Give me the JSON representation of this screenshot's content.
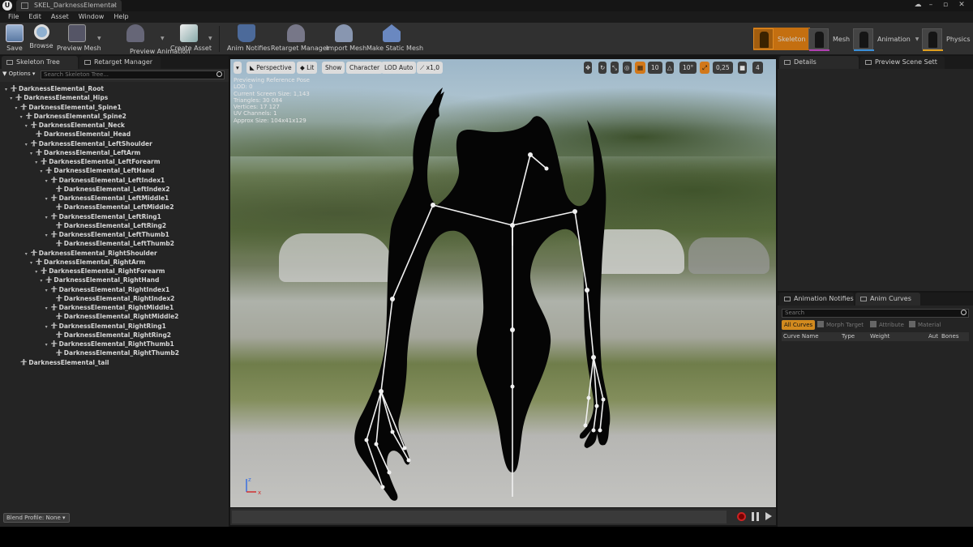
{
  "window": {
    "tab_title": "SKEL_DarknessElemental",
    "logo": "U"
  },
  "menu": [
    "File",
    "Edit",
    "Asset",
    "Window",
    "Help"
  ],
  "toolbar": {
    "save": "Save",
    "browse": "Browse",
    "preview_mesh": "Preview Mesh",
    "preview_animation": "Preview Animation",
    "create_asset": "Create Asset",
    "anim_notifies": "Anim Notifies",
    "retarget_manager": "Retarget Manager",
    "import_mesh": "Import Mesh",
    "make_static_mesh": "Make Static Mesh"
  },
  "modes": {
    "skeleton": "Skeleton",
    "mesh": "Mesh",
    "animation": "Animation",
    "physics": "Physics"
  },
  "left_panel": {
    "tab_skeleton_tree": "Skeleton Tree",
    "tab_retarget_manager": "Retarget Manager",
    "options": "Options",
    "search_placeholder": "Search Skeleton Tree...",
    "blend_profile": "Blend Profile: None",
    "bones": [
      {
        "name": "DarknessElemental_Root",
        "depth": 0
      },
      {
        "name": "DarknessElemental_Hips",
        "depth": 1
      },
      {
        "name": "DarknessElemental_Spine1",
        "depth": 2
      },
      {
        "name": "DarknessElemental_Spine2",
        "depth": 3
      },
      {
        "name": "DarknessElemental_Neck",
        "depth": 4
      },
      {
        "name": "DarknessElemental_Head",
        "depth": 5
      },
      {
        "name": "DarknessElemental_LeftShoulder",
        "depth": 4
      },
      {
        "name": "DarknessElemental_LeftArm",
        "depth": 5
      },
      {
        "name": "DarknessElemental_LeftForearm",
        "depth": 6
      },
      {
        "name": "DarknessElemental_LeftHand",
        "depth": 7
      },
      {
        "name": "DarknessElemental_LeftIndex1",
        "depth": 8
      },
      {
        "name": "DarknessElemental_LeftIndex2",
        "depth": 9
      },
      {
        "name": "DarknessElemental_LeftMiddle1",
        "depth": 8
      },
      {
        "name": "DarknessElemental_LeftMiddle2",
        "depth": 9
      },
      {
        "name": "DarknessElemental_LeftRing1",
        "depth": 8
      },
      {
        "name": "DarknessElemental_LeftRing2",
        "depth": 9
      },
      {
        "name": "DarknessElemental_LeftThumb1",
        "depth": 8
      },
      {
        "name": "DarknessElemental_LeftThumb2",
        "depth": 9
      },
      {
        "name": "DarknessElemental_RightShoulder",
        "depth": 4
      },
      {
        "name": "DarknessElemental_RightArm",
        "depth": 5
      },
      {
        "name": "DarknessElemental_RightForearm",
        "depth": 6
      },
      {
        "name": "DarknessElemental_RightHand",
        "depth": 7
      },
      {
        "name": "DarknessElemental_RightIndex1",
        "depth": 8
      },
      {
        "name": "DarknessElemental_RightIndex2",
        "depth": 9
      },
      {
        "name": "DarknessElemental_RightMiddle1",
        "depth": 8
      },
      {
        "name": "DarknessElemental_RightMiddle2",
        "depth": 9
      },
      {
        "name": "DarknessElemental_RightRing1",
        "depth": 8
      },
      {
        "name": "DarknessElemental_RightRing2",
        "depth": 9
      },
      {
        "name": "DarknessElemental_RightThumb1",
        "depth": 8
      },
      {
        "name": "DarknessElemental_RightThumb2",
        "depth": 9
      },
      {
        "name": "DarknessElemental_tail",
        "depth": 2
      }
    ]
  },
  "viewport": {
    "perspective": "Perspective",
    "lit": "Lit",
    "show": "Show",
    "character": "Character",
    "lod": "LOD Auto",
    "speed": "x1,0",
    "grid_snap": "10",
    "rot_snap": "10°",
    "scale_snap": "0,25",
    "cam_speed": "4",
    "stats": [
      "Previewing Reference Pose",
      "LOD: 0",
      "Current Screen Size: 1,143",
      "Triangles: 30 084",
      "Vertices: 17 127",
      "UV Channels: 1",
      "Approx Size: 104x41x129"
    ]
  },
  "right_panel": {
    "details": "Details",
    "preview_scene": "Preview Scene Sett",
    "anim_notifies": "Animation Notifies",
    "anim_curves": "Anim Curves",
    "search_placeholder": "Search",
    "filters": [
      "All Curves",
      "Morph Target",
      "Attribute",
      "Material"
    ],
    "columns": [
      "Curve Name",
      "Type",
      "Weight",
      "Auto",
      "Bones"
    ]
  },
  "colors": {
    "accent": "#c46f10",
    "panel": "#242424",
    "mesh_underline": "#b040b0",
    "anim_underline": "#3a8fd8",
    "physics_underline": "#e0a020"
  }
}
